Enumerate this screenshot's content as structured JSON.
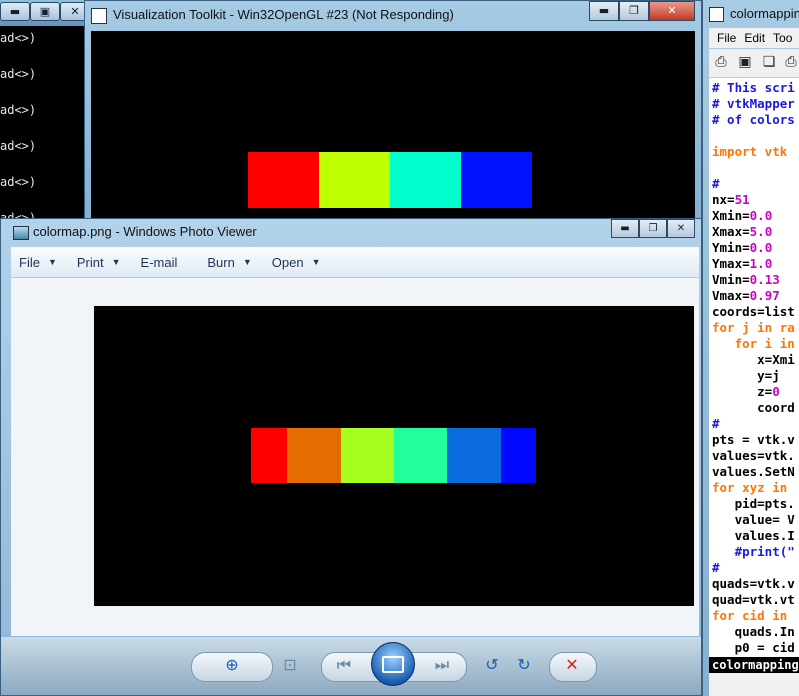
{
  "console": {
    "lines": [
      "ad<>)",
      "ad<>)",
      "ad<>)",
      "ad<>)",
      "ad<>)",
      "ad<>)"
    ]
  },
  "vtk_window": {
    "title": "Visualization Toolkit - Win32OpenGL #23 (Not Responding)",
    "controls": [
      "▬",
      "❐",
      "✕"
    ],
    "colorbar_colors": [
      "#ff0000",
      "#c0ff00",
      "#00ffcc",
      "#0012ff"
    ]
  },
  "photo_viewer": {
    "title": "colormap.png - Windows Photo Viewer",
    "menu": [
      {
        "label": "File",
        "has_arrow": true
      },
      {
        "label": "Print",
        "has_arrow": true
      },
      {
        "label": "E-mail",
        "has_arrow": false
      },
      {
        "label": "Burn",
        "has_arrow": true
      },
      {
        "label": "Open",
        "has_arrow": true
      }
    ],
    "image_colors": [
      "#ff0000",
      "#e56c00",
      "#a5ff20",
      "#20ff99",
      "#0a6cdc",
      "#0008ff"
    ],
    "toolbar_icons": [
      "zoom-icon",
      "actual-size-icon",
      "previous-icon",
      "slideshow-icon",
      "next-icon",
      "rotate-counterclockwise-icon",
      "rotate-clockwise-icon",
      "delete-icon"
    ]
  },
  "idle_window": {
    "title": "colormappin",
    "menu": [
      "File",
      "Edit",
      "Too"
    ],
    "code_lines": [
      {
        "text": "# This scri",
        "color": "#1a1add"
      },
      {
        "text": "# vtkMapper",
        "color": "#1a1add"
      },
      {
        "text": "# of colors",
        "color": "#1a1add"
      },
      {
        "text": "",
        "color": "#000000"
      },
      {
        "text": "import vtk",
        "color": "#ff7700",
        "mixed": true
      },
      {
        "text": "",
        "color": "#000000"
      },
      {
        "text": "#",
        "color": "#1a1add"
      },
      {
        "text": "nx=51",
        "color": "#000000"
      },
      {
        "text": "Xmin=0.0",
        "color": "#000000"
      },
      {
        "text": "Xmax=5.0",
        "color": "#000000"
      },
      {
        "text": "Ymin=0.0",
        "color": "#000000"
      },
      {
        "text": "Ymax=1.0",
        "color": "#000000"
      },
      {
        "text": "Vmin=0.13",
        "color": "#000000"
      },
      {
        "text": "Vmax=0.97",
        "color": "#000000"
      },
      {
        "text": "coords=list",
        "color": "#000000"
      },
      {
        "text": "for j in ra",
        "color": "#000000"
      },
      {
        "text": "   for i in",
        "color": "#000000"
      },
      {
        "text": "      x=Xmi",
        "color": "#000000"
      },
      {
        "text": "      y=j",
        "color": "#000000"
      },
      {
        "text": "      z=0",
        "color": "#000000"
      },
      {
        "text": "      coord",
        "color": "#000000"
      },
      {
        "text": "#",
        "color": "#1a1add"
      },
      {
        "text": "pts = vtk.v",
        "color": "#000000"
      },
      {
        "text": "values=vtk.",
        "color": "#000000"
      },
      {
        "text": "values.SetN",
        "color": "#000000"
      },
      {
        "text": "for xyz in",
        "color": "#000000"
      },
      {
        "text": "   pid=pts.",
        "color": "#000000"
      },
      {
        "text": "   value= V",
        "color": "#000000"
      },
      {
        "text": "   values.I",
        "color": "#000000"
      },
      {
        "text": "   #print(\"",
        "color": "#1a1add"
      },
      {
        "text": "#",
        "color": "#1a1add"
      },
      {
        "text": "quads=vtk.v",
        "color": "#000000"
      },
      {
        "text": "quad=vtk.vt",
        "color": "#000000"
      },
      {
        "text": "for cid in",
        "color": "#000000"
      },
      {
        "text": "   quads.In",
        "color": "#000000"
      },
      {
        "text": "   p0 = cid",
        "color": "#000000"
      }
    ],
    "status": "colormapping"
  }
}
